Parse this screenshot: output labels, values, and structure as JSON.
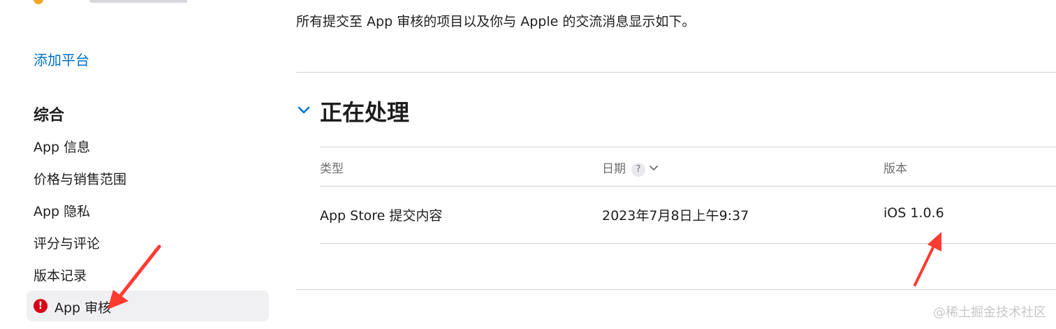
{
  "sidebar": {
    "add_platform": "添加平台",
    "section_title": "综合",
    "items": [
      {
        "label": "App 信息"
      },
      {
        "label": "价格与销售范围"
      },
      {
        "label": "App 隐私"
      },
      {
        "label": "评分与评论"
      },
      {
        "label": "版本记录"
      },
      {
        "label": "App 审核",
        "active": true,
        "status_icon": "alert-icon"
      }
    ]
  },
  "main": {
    "intro": "所有提交至 App 审核的项目以及你与 Apple 的交流消息显示如下。",
    "section": {
      "title": "正在处理",
      "columns": {
        "type": "类型",
        "date": "日期",
        "version": "版本"
      },
      "date_help_icon": "?",
      "rows": [
        {
          "type": "App Store 提交内容",
          "date": "2023年7月8日上午9:37",
          "version": "iOS 1.0.6"
        }
      ]
    }
  },
  "watermark": "@稀土掘金技术社区",
  "colors": {
    "link": "#0070c9",
    "alert": "#d70015",
    "annotation": "#ff3b30",
    "active_bg": "#f0f0f2"
  }
}
